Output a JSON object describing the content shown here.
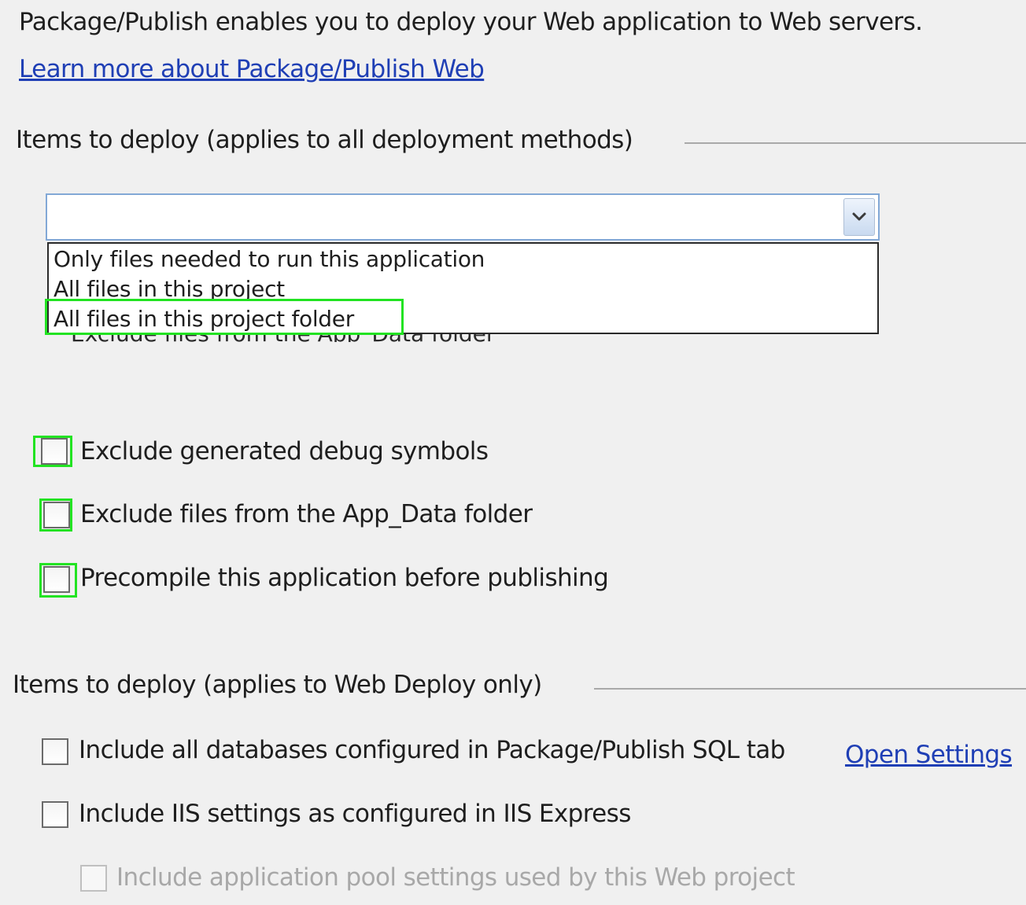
{
  "intro_text": "Package/Publish enables you to deploy your Web application to Web servers.",
  "learn_more_link": "Learn more about Package/Publish Web",
  "group1": {
    "header": "Items to deploy (applies to all deployment methods)",
    "combo_value": "",
    "dropdown_options": [
      "Only files needed to run this application",
      "All files in this project",
      "All files in this project folder"
    ],
    "highlighted_option": "All files in this project folder",
    "hidden_underlying_text": "Exclude files from the App_Data folder",
    "checkboxes": [
      {
        "label": "Exclude generated debug symbols",
        "checked": false
      },
      {
        "label": "Exclude files from the App_Data folder",
        "checked": false
      },
      {
        "label": "Precompile this application before publishing",
        "checked": false
      }
    ]
  },
  "group2": {
    "header": "Items to deploy (applies to Web Deploy only)",
    "checkboxes": [
      {
        "label": "Include all databases configured in Package/Publish SQL tab",
        "checked": false
      },
      {
        "label": "Include IIS settings as configured in IIS Express",
        "checked": false
      },
      {
        "label": "Include application pool settings used by this Web project",
        "checked": false,
        "disabled": true
      }
    ],
    "open_settings_link": "Open Settings"
  },
  "colors": {
    "background": "#f0f0f0",
    "link": "#1f3fb5",
    "highlight": "#22e322",
    "disabled_text": "#a8a8a8"
  }
}
